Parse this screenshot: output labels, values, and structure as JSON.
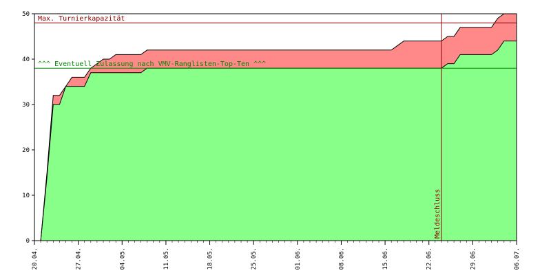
{
  "chart_data": {
    "type": "area",
    "title": "",
    "xlabel": "",
    "ylabel": "",
    "ylim": [
      0,
      50
    ],
    "yticks": [
      0,
      10,
      20,
      30,
      40,
      50
    ],
    "xlim": [
      "2025-04-20",
      "2025-07-06"
    ],
    "xtick_labels": [
      "20.04.",
      "27.04.",
      "04.05.",
      "11.05.",
      "18.05.",
      "25.05.",
      "01.06.",
      "08.06.",
      "15.06.",
      "22.06.",
      "29.06.",
      "06.07."
    ],
    "grid": false,
    "colors": {
      "upper_area": "#ff8888",
      "lower_area": "#88ff88",
      "capacity_line": "#880000",
      "top_ten_line": "#008800",
      "deadline_line": "#880000"
    },
    "series": [
      {
        "key": "upper",
        "x": [
          "2025-04-20",
          "2025-04-21",
          "2025-04-22",
          "2025-04-23",
          "2025-04-24",
          "2025-04-25",
          "2025-04-26",
          "2025-04-27",
          "2025-04-28",
          "2025-04-29",
          "2025-04-30",
          "2025-05-01",
          "2025-05-02",
          "2025-05-03",
          "2025-05-04",
          "2025-05-07",
          "2025-05-08",
          "2025-05-09",
          "2025-06-16",
          "2025-06-17",
          "2025-06-18",
          "2025-06-19",
          "2025-06-23",
          "2025-06-24",
          "2025-06-25",
          "2025-06-26",
          "2025-06-27",
          "2025-07-02",
          "2025-07-03",
          "2025-07-04",
          "2025-07-05",
          "2025-07-06"
        ],
        "y": [
          0,
          0,
          15,
          32,
          32,
          34,
          36,
          36,
          36,
          38,
          39,
          40,
          40,
          41,
          41,
          41,
          42,
          42,
          42,
          43,
          44,
          44,
          44,
          44,
          45,
          45,
          47,
          47,
          49,
          50,
          50,
          50
        ]
      },
      {
        "key": "lower",
        "x": [
          "2025-04-20",
          "2025-04-21",
          "2025-04-22",
          "2025-04-23",
          "2025-04-24",
          "2025-04-25",
          "2025-04-26",
          "2025-04-27",
          "2025-04-28",
          "2025-04-29",
          "2025-04-30",
          "2025-05-01",
          "2025-05-02",
          "2025-05-03",
          "2025-05-04",
          "2025-05-07",
          "2025-05-08",
          "2025-05-09",
          "2025-06-16",
          "2025-06-17",
          "2025-06-18",
          "2025-06-19",
          "2025-06-23",
          "2025-06-24",
          "2025-06-25",
          "2025-06-26",
          "2025-06-27",
          "2025-07-02",
          "2025-07-03",
          "2025-07-04",
          "2025-07-05",
          "2025-07-06"
        ],
        "y": [
          0,
          0,
          14,
          30,
          30,
          34,
          34,
          34,
          34,
          37,
          37,
          37,
          37,
          37,
          37,
          37,
          38,
          38,
          38,
          38,
          38,
          38,
          38,
          38,
          39,
          39,
          41,
          41,
          42,
          44,
          44,
          44
        ]
      }
    ],
    "reference_lines": [
      {
        "key": "capacity",
        "axis": "y",
        "value": 48,
        "label": "Max. Turnierkapazität"
      },
      {
        "key": "top_ten",
        "axis": "y",
        "value": 38,
        "label": "^^^ Eventuell Zulassung nach VMV-Ranglisten-Top-Ten ^^^"
      },
      {
        "key": "deadline",
        "axis": "x",
        "value": "2025-06-24",
        "label": "Meldeschluss"
      }
    ]
  }
}
